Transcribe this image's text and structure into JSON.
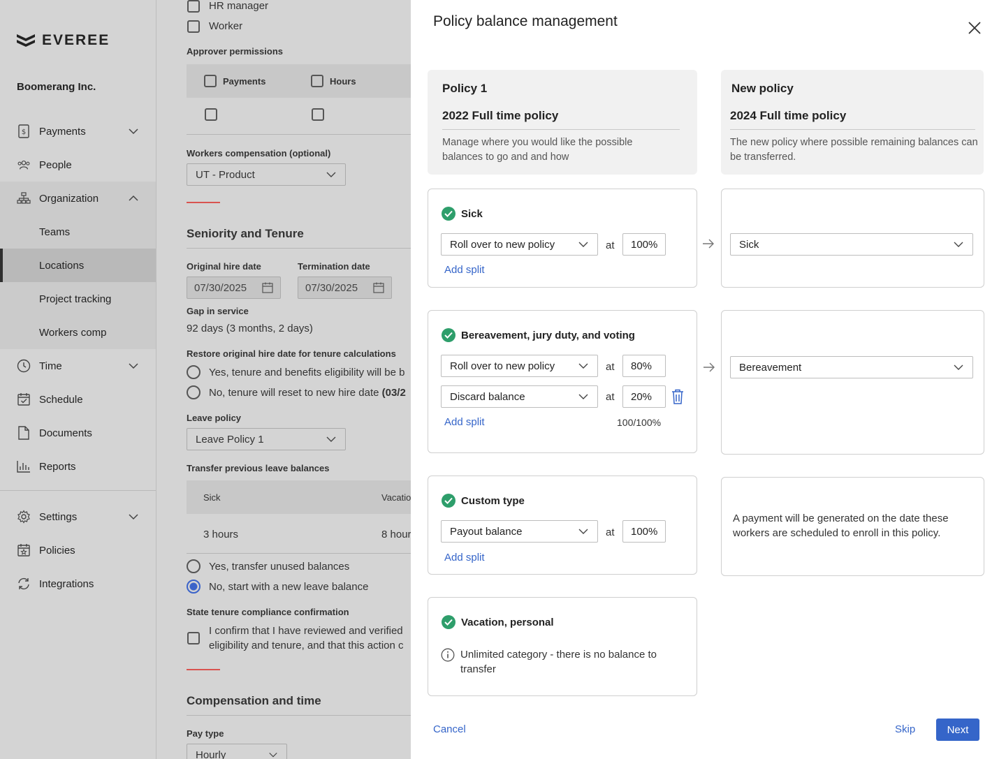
{
  "brand": {
    "name": "EVEREE",
    "company": "Boomerang Inc."
  },
  "sidebar": {
    "items": [
      {
        "label": "Payments",
        "icon": "payments-icon"
      },
      {
        "label": "People",
        "icon": "people-icon"
      },
      {
        "label": "Organization",
        "icon": "organization-icon"
      },
      {
        "label": "Time",
        "icon": "clock-icon"
      },
      {
        "label": "Schedule",
        "icon": "calendar-check-icon"
      },
      {
        "label": "Documents",
        "icon": "document-icon"
      },
      {
        "label": "Reports",
        "icon": "bar-chart-icon"
      },
      {
        "label": "Settings",
        "icon": "gear-icon"
      },
      {
        "label": "Policies",
        "icon": "calendar-star-icon"
      },
      {
        "label": "Integrations",
        "icon": "sync-icon"
      }
    ],
    "org_sub": [
      "Teams",
      "Locations",
      "Project tracking",
      "Workers comp"
    ],
    "active_sub": "Locations"
  },
  "form": {
    "roles": [
      "HR manager",
      "Worker"
    ],
    "approver_label": "Approver permissions",
    "approver_cols": [
      "Payments",
      "Hours"
    ],
    "wc_label": "Workers compensation (optional)",
    "wc_value": "UT - Product",
    "seniority_title": "Seniority and Tenure",
    "hire_label": "Original hire date",
    "hire_value": "07/30/2025",
    "term_label": "Termination date",
    "term_value": "07/30/2025",
    "gap_label": "Gap in service",
    "gap_value": "92 days (3 months, 2 days)",
    "restore_label": "Restore original hire date for tenure calculations",
    "restore_yes": "Yes, tenure and benefits eligibility will be b",
    "restore_no_a": "No, tenure will reset to new hire date ",
    "restore_no_b": "(03/2",
    "leave_label": "Leave policy",
    "leave_value": "Leave Policy 1",
    "transfer_label": "Transfer previous leave balances",
    "transfer_cols": [
      "Sick",
      "Vacatio"
    ],
    "transfer_vals": [
      "3 hours",
      "8 hour"
    ],
    "transfer_yes": "Yes, transfer unused balances",
    "transfer_no": "No, start with a new leave balance",
    "compliance_label": "State tenure compliance confirmation",
    "compliance_line1": "I confirm that I have reviewed and verified",
    "compliance_line2": "eligibility and tenure, and that this action c",
    "comp_title": "Compensation and time",
    "paytype_label": "Pay type",
    "paytype_value": "Hourly"
  },
  "modal": {
    "title": "Policy balance management",
    "left_header": {
      "label": "Policy 1",
      "name": "2022 Full time policy",
      "desc": "Manage where you would like the possible balances to go and and how"
    },
    "right_header": {
      "label": "New policy",
      "name": "2024 Full time policy",
      "desc": "The new policy where possible remaining balances can be transferred."
    },
    "at_label": "at",
    "add_split": "Add split",
    "sick": {
      "title": "Sick",
      "action": "Roll over to new policy",
      "pct": "100%",
      "target": "Sick"
    },
    "bereavement": {
      "title": "Bereavement, jury duty, and voting",
      "action1": "Roll over to new policy",
      "pct1": "80%",
      "action2": "Discard balance",
      "pct2": "20%",
      "total": "100/100%",
      "target": "Bereavement"
    },
    "custom": {
      "title": "Custom type",
      "action": "Payout balance",
      "pct": "100%",
      "note": "A payment will be generated on the date these workers are scheduled to enroll in this policy."
    },
    "vacation": {
      "title": "Vacation, personal",
      "info": "Unlimited category - there is no balance to transfer"
    },
    "footer": {
      "cancel": "Cancel",
      "skip": "Skip",
      "next": "Next"
    },
    "colors": {
      "accent": "#3565c9",
      "success": "#2e9e6b"
    }
  }
}
